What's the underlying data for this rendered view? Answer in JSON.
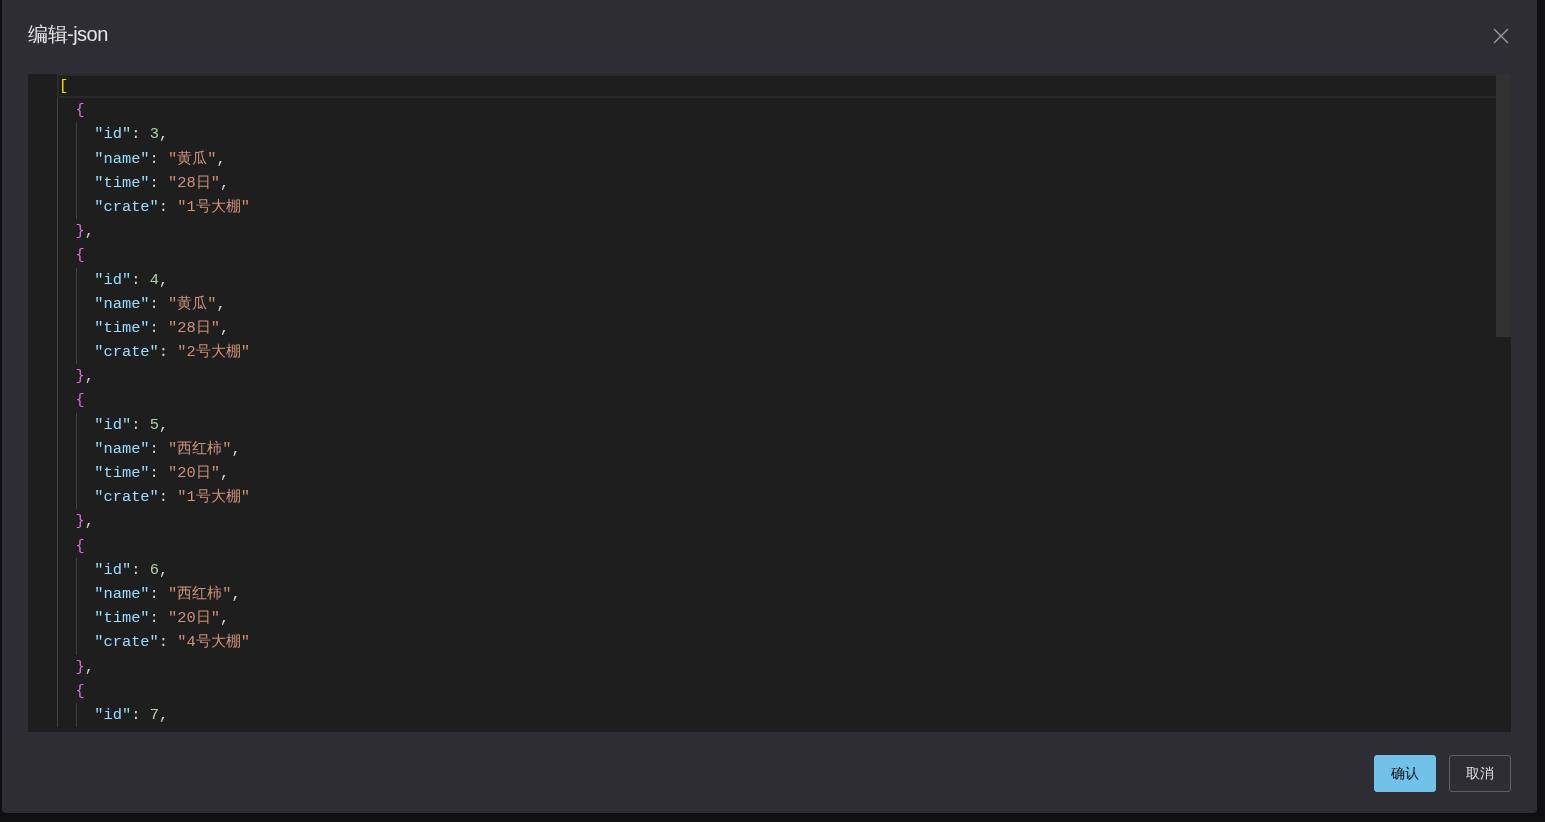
{
  "dialog": {
    "title": "编辑-json",
    "editor": {
      "root": {
        "text": "[",
        "active": true
      },
      "items": [
        {
          "open": "{",
          "fields": [
            {
              "key": "\"id\"",
              "colon": ":",
              "value": "3",
              "kind": "number",
              "comma": ","
            },
            {
              "key": "\"name\"",
              "colon": ":",
              "value": "\"黄瓜\"",
              "kind": "string",
              "comma": ","
            },
            {
              "key": "\"time\"",
              "colon": ":",
              "value": "\"28日\"",
              "kind": "string",
              "comma": ","
            },
            {
              "key": "\"crate\"",
              "colon": ":",
              "value": "\"1号大棚\"",
              "kind": "string"
            }
          ],
          "close": "}",
          "comma": ","
        },
        {
          "open": "{",
          "fields": [
            {
              "key": "\"id\"",
              "colon": ":",
              "value": "4",
              "kind": "number",
              "comma": ","
            },
            {
              "key": "\"name\"",
              "colon": ":",
              "value": "\"黄瓜\"",
              "kind": "string",
              "comma": ","
            },
            {
              "key": "\"time\"",
              "colon": ":",
              "value": "\"28日\"",
              "kind": "string",
              "comma": ","
            },
            {
              "key": "\"crate\"",
              "colon": ":",
              "value": "\"2号大棚\"",
              "kind": "string"
            }
          ],
          "close": "}",
          "comma": ","
        },
        {
          "open": "{",
          "fields": [
            {
              "key": "\"id\"",
              "colon": ":",
              "value": "5",
              "kind": "number",
              "comma": ","
            },
            {
              "key": "\"name\"",
              "colon": ":",
              "value": "\"西红柿\"",
              "kind": "string",
              "comma": ","
            },
            {
              "key": "\"time\"",
              "colon": ":",
              "value": "\"20日\"",
              "kind": "string",
              "comma": ","
            },
            {
              "key": "\"crate\"",
              "colon": ":",
              "value": "\"1号大棚\"",
              "kind": "string"
            }
          ],
          "close": "}",
          "comma": ","
        },
        {
          "open": "{",
          "fields": [
            {
              "key": "\"id\"",
              "colon": ":",
              "value": "6",
              "kind": "number",
              "comma": ","
            },
            {
              "key": "\"name\"",
              "colon": ":",
              "value": "\"西红柿\"",
              "kind": "string",
              "comma": ","
            },
            {
              "key": "\"time\"",
              "colon": ":",
              "value": "\"20日\"",
              "kind": "string",
              "comma": ","
            },
            {
              "key": "\"crate\"",
              "colon": ":",
              "value": "\"4号大棚\"",
              "kind": "string"
            }
          ],
          "close": "}",
          "comma": ","
        },
        {
          "open": "{",
          "fields": [
            {
              "key": "\"id\"",
              "colon": ":",
              "value": "7",
              "kind": "number",
              "comma": ","
            }
          ]
        }
      ]
    },
    "buttons": [
      {
        "label": "确认",
        "kind": "primary"
      },
      {
        "label": "取消",
        "kind": "secondary"
      }
    ]
  }
}
